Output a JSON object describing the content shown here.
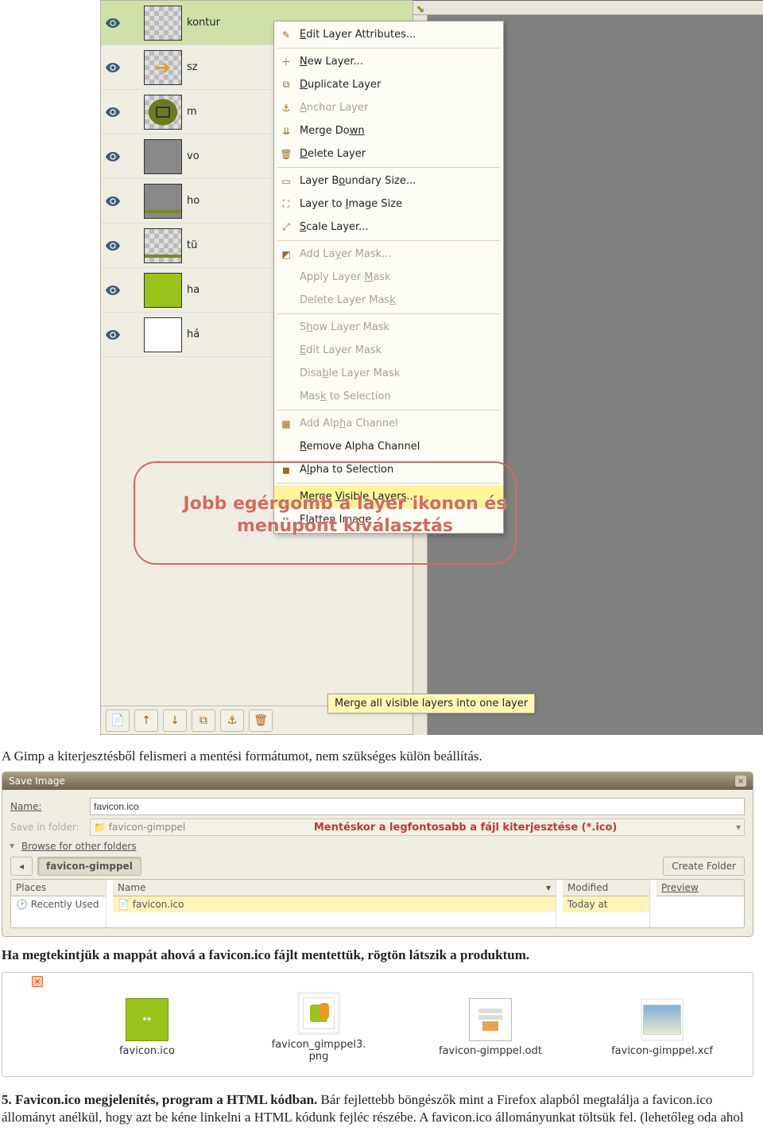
{
  "layers": {
    "items": [
      {
        "name": "kontur",
        "thumb": "checker-green-outline"
      },
      {
        "name": "sz",
        "thumb": "arrow"
      },
      {
        "name": "m",
        "thumb": "green-cross"
      },
      {
        "name": "vo",
        "thumb": "grey"
      },
      {
        "name": "ho",
        "thumb": "grey-line"
      },
      {
        "name": "tü",
        "thumb": "checker-line"
      },
      {
        "name": "ha",
        "thumb": "solid-green"
      },
      {
        "name": "há",
        "thumb": "white"
      }
    ],
    "toolbar_buttons": [
      "new-layer",
      "up",
      "down",
      "dup",
      "anchor",
      "delete"
    ]
  },
  "context_menu": {
    "groups": [
      [
        {
          "label": "Edit Layer Attributes...",
          "u": "E",
          "icon": "edit-icon",
          "enabled": true
        }
      ],
      [
        {
          "label": "New Layer...",
          "u": "N",
          "icon": "new-icon",
          "enabled": true
        },
        {
          "label": "Duplicate Layer",
          "u": "D",
          "icon": "dup-icon",
          "enabled": true
        },
        {
          "label": "Anchor Layer",
          "u": "A",
          "icon": "anchor-icon",
          "enabled": false
        },
        {
          "label": "Merge Down",
          "u2": "wn",
          "icon": "merge-icon",
          "enabled": true
        },
        {
          "label": "Delete Layer",
          "u": "D",
          "icon": "trash-icon",
          "enabled": true
        }
      ],
      [
        {
          "label": "Layer Boundary Size...",
          "u": "o",
          "icon": "bounds-icon",
          "enabled": true
        },
        {
          "label": "Layer to Image Size",
          "u": "I",
          "icon": "fit-icon",
          "enabled": true
        },
        {
          "label": "Scale Layer...",
          "u": "S",
          "icon": "scale-icon",
          "enabled": true
        }
      ],
      [
        {
          "label": "Add Layer Mask...",
          "u": "y",
          "icon": "mask-icon",
          "enabled": false
        },
        {
          "label": "Apply Layer Mask",
          "u": "M",
          "icon": "",
          "enabled": false
        },
        {
          "label": "Delete Layer Mask",
          "u": "k",
          "icon": "",
          "enabled": false
        }
      ],
      [
        {
          "label": "Show Layer Mask",
          "u": "h",
          "icon": "",
          "enabled": false
        },
        {
          "label": "Edit Layer Mask",
          "u": "E",
          "icon": "",
          "enabled": false
        },
        {
          "label": "Disable Layer Mask",
          "u": "b",
          "icon": "",
          "enabled": false
        },
        {
          "label": "Mask to Selection",
          "u": "k",
          "icon": "",
          "enabled": false
        }
      ],
      [
        {
          "label": "Add Alpha Channel",
          "u": "h",
          "icon": "alpha-add-icon",
          "enabled": false
        },
        {
          "label": "Remove Alpha Channel",
          "u": "R",
          "icon": "",
          "enabled": true
        },
        {
          "label": "Alpha to Selection",
          "u": "l",
          "icon": "alpha-sel-icon",
          "enabled": true
        }
      ],
      [
        {
          "label": "Merge Visible Layers...",
          "u": "V",
          "icon": "",
          "enabled": true,
          "hover": true
        },
        {
          "label": "Flatten Image",
          "u": "F",
          "icon": "",
          "enabled": true
        }
      ]
    ],
    "tooltip": "Merge all visible layers into one layer"
  },
  "annotation": {
    "text": "Jobb egérgomb a layer ikonon és menüpont kiválasztás"
  },
  "body_text": {
    "p1": "A Gimp a kiterjesztésből felismeri a mentési formátumot, nem szükséges külön beállítás.",
    "p2": "Ha megtekintjük a mappát ahová a favicon.ico fájlt mentettük, rögtön látszik a produktum.",
    "h5": "5. Favicon.ico megjelenítés, program a HTML kódban.",
    "p3a": " Bár fejlettebb böngészők mint a Firefox alapból megtalálja a favicon.ico állományt anélkül, hogy azt be kéne linkelni a HTML kódunk fejléc részébe. A favicon.ico állományunkat töltsük fel. (lehetőleg oda ahol"
  },
  "save_dialog": {
    "title": "Save Image",
    "name_label": "Name:",
    "name_value": "favicon.ico",
    "folder_label": "Save in folder:",
    "folder_value": "favicon-gimppel",
    "red_note": "Mentéskor a legfontosabb a fájl kiterjesztése (*.ico)",
    "browse": "Browse for other folders",
    "path_current": "favicon-gimppel",
    "create_folder": "Create Folder",
    "places_hdr": "Places",
    "places_item": "Recently Used",
    "name_hdr": "Name",
    "name_item": "favicon.ico",
    "mod_hdr": "Modified",
    "mod_item": "Today at",
    "preview_hdr": "Preview"
  },
  "file_manager": {
    "items": [
      {
        "name": "favicon.ico",
        "kind": "ico"
      },
      {
        "name": "favicon_gimppel3.\npng",
        "kind": "png"
      },
      {
        "name": "favicon-gimppel.odt",
        "kind": "odt"
      },
      {
        "name": "favicon-gimppel.xcf",
        "kind": "xcf"
      }
    ]
  }
}
